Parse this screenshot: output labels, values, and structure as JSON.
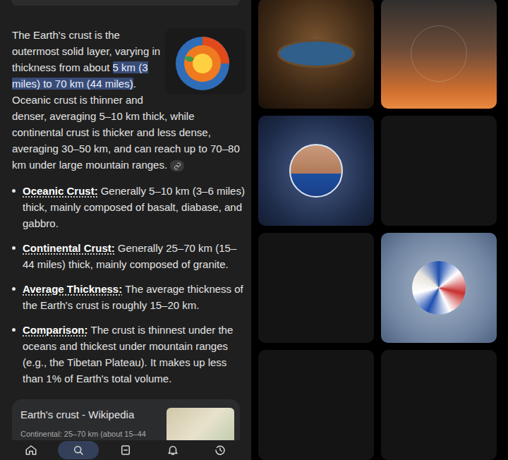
{
  "answer": {
    "before": "The Earth's crust is the outermost solid layer, varying in thickness from about ",
    "highlight": "5 km (3 miles) to 70 km (44 miles)",
    "after": ". Oceanic crust is thinner and denser, averaging 5–10 km thick, while continental crust is thicker and less dense, averaging 30–50 km, and can reach up to 70–80 km under large mountain ranges."
  },
  "bullets": [
    {
      "label": "Oceanic Crust:",
      "text": "Generally 5–10 km (3–6 miles) thick, mainly composed of basalt, diabase, and gabbro."
    },
    {
      "label": "Continental Crust:",
      "text": "Generally 25–70 km (15–44 miles) thick, mainly composed of granite."
    },
    {
      "label": "Average Thickness:",
      "text": "The average thickness of the Earth's crust is roughly 15–20 km."
    },
    {
      "label": "Comparison:",
      "text": "The crust is thinnest under the oceans and thickest under mountain ranges (e.g., the Tibetan Plateau). It makes up less than 1% of Earth's total volume."
    }
  ],
  "source_card": {
    "title": "Earth's crust - Wikipedia",
    "snippet": "Continental: 25–70 km (about 15–44"
  },
  "nav": [
    {
      "kind": "home",
      "selected": false
    },
    {
      "kind": "search",
      "selected": true
    },
    {
      "kind": "collections",
      "selected": false
    },
    {
      "kind": "notifications",
      "selected": false
    },
    {
      "kind": "history",
      "selected": false
    }
  ],
  "tiles": [
    {
      "kind": "photo"
    },
    {
      "kind": "sunset"
    },
    {
      "kind": "avatar"
    },
    {
      "kind": "empty"
    },
    {
      "kind": "empty"
    },
    {
      "kind": "emblem"
    },
    {
      "kind": "empty"
    },
    {
      "kind": "empty"
    }
  ]
}
